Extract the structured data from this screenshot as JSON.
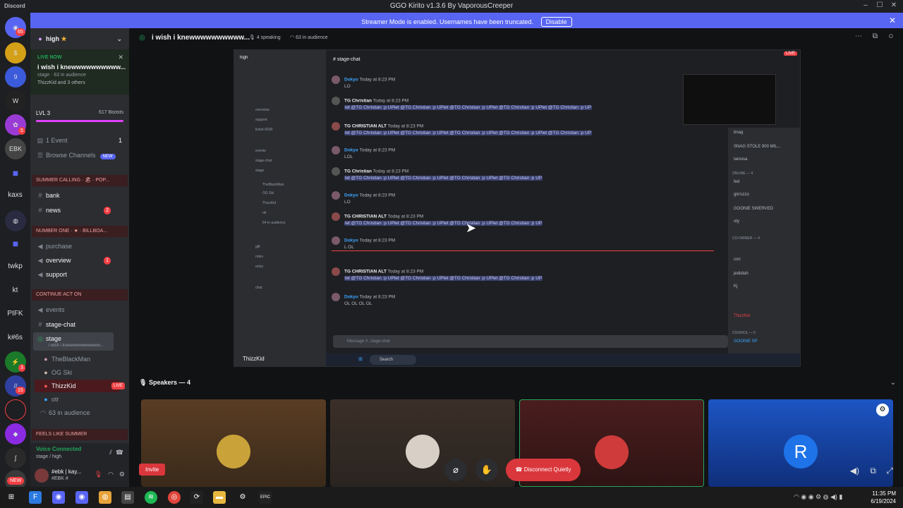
{
  "titlebar": {
    "app": "Discord",
    "title": "GGO Kirito v1.3.6 By VaporousCreeper"
  },
  "streamer_banner": {
    "text": "Streamer Mode is enabled. Usernames have been truncated.",
    "button": "Disable"
  },
  "guild_rail": {
    "badges": [
      "65",
      "5",
      "3",
      "15"
    ],
    "text_items": [
      "kaxs",
      "twkp",
      "kt",
      "PIFK",
      "k#6s"
    ],
    "new_badge": "NEW"
  },
  "sidebar": {
    "server_name": "high",
    "live_label": "LIVE NOW",
    "live_title": "i wish i knewwwwwwwwww...",
    "live_sub": "stage · 63 in audience",
    "live_people": "ThizzKid and 3 others",
    "level": "LVL 3",
    "boosts": "617 Boosts",
    "events": "1 Event",
    "events_count": "1",
    "browse": "Browse Channels",
    "browse_badge": "NEW",
    "cat1": "SUMMER CALLING · 🏖 · POP...",
    "bank": "bank",
    "news": "news",
    "news_badge": "2",
    "cat2": "NUMBER ONE · ★ · BILLBOA...",
    "purchase": "purchase",
    "overview": "overview",
    "overview_badge": "1",
    "support": "support",
    "cat3": "CONTINUE ACT ON",
    "events_ch": "events",
    "stage_chat": "stage-chat",
    "stage": "stage",
    "stage_sub": "i wish i knewwwwwwwwww...",
    "users": [
      "TheBlackMan",
      "OG Ski",
      "ThizzKid",
      "otr"
    ],
    "live_tag": "LIVE",
    "audience": "63 in audience",
    "cat4": "FEELS LIKE SUMMER",
    "voice_connected": "Voice Connected",
    "voice_sub": "stage / high",
    "user_name": "#ebk | kay...",
    "user_tag": "#EBK #"
  },
  "stage_header": {
    "title": "i wish i knewwwwwwwwww...",
    "speaking": "4 speaking",
    "audience": "63 in audience"
  },
  "stream": {
    "mini_server": "high",
    "mini_channels": [
      "overview",
      "support",
      "ticket-0030",
      "events",
      "stage-chat",
      "stage",
      "TheBlackMan",
      "OG Ski",
      "ThizzKid",
      "otr",
      "64 in audience",
      "gift",
      "roles",
      "entry",
      "chat"
    ],
    "mini_user": "ThizzKid",
    "channel": "stage-chat",
    "message_placeholder": "Message #, stage-chat",
    "messages": [
      {
        "name": "Dokyo",
        "time": "Today at 8:23 PM",
        "text": "LO"
      },
      {
        "name": "TG Christian",
        "time": "Today at 8:23 PM",
        "text": "let @TG Christian :p UPlet @TG Christian :p UPlet @TG Christian :p UPlet @TG Christian :p UPlet @TG Christian :p UP"
      },
      {
        "name": "TG CHRISTIAN ALT",
        "time": "Today at 8:23 PM",
        "text": "let @TG Christian :p UPlet @TG Christian :p UPlet @TG Christian :p UPlet @TG Christian :p UPlet @TG Christian :p UP"
      },
      {
        "name": "Dokyo",
        "time": "Today at 8:23 PM",
        "text": "LOL"
      },
      {
        "name": "TG Christian",
        "time": "Today at 8:23 PM",
        "text": "let @TG Christian :p UPlet @TG Christian :p UPlet @TG Christian :p UPlet @TG Christian :p UP"
      },
      {
        "name": "Dokyo",
        "time": "Today at 8:23 PM",
        "text": "LO"
      },
      {
        "name": "TG CHRISTIAN ALT",
        "time": "Today at 8:23 PM",
        "text": "let @TG Christian :p UPlet @TG Christian :p UPlet @TG Christian :p UPlet @TG Christian :p UP"
      },
      {
        "name": "Dokyo",
        "time": "Today at 8:23 PM",
        "text": "L  OL"
      },
      {
        "name": "TG CHRISTIAN ALT",
        "time": "Today at 8:23 PM",
        "text": "let @TG Christian :p UPlet @TG Christian :p UPlet @TG Christian :p UPlet @TG Christian :p UP"
      },
      {
        "name": "Dokyo",
        "time": "Today at 8:23 PM",
        "text": "OL OL OL OL"
      }
    ],
    "members": [
      "bnag",
      "SNAG STOLE 900 MIL...",
      "tainosa",
      "fed",
      "glo'ozzo",
      "GOONIE SWERVED",
      "oty",
      "con",
      "jedidiah",
      "Kj",
      "ThizzKid",
      "GOONIE SP"
    ],
    "member_sections": [
      "ONLINE — 4",
      "CO-OWNER — 4",
      "COUNCIL — 6"
    ],
    "live_tag": "LIVE",
    "taskbar_search": "Search"
  },
  "speakers": {
    "heading": "Speakers — 4",
    "invite": "Invite",
    "disconnect": "Disconnect Quietly"
  },
  "taskbar": {
    "time": "11:35 PM",
    "date": "6/19/2024"
  },
  "colors": {
    "blurple": "#5865f2",
    "red": "#da373c",
    "live": "#ed4245",
    "green": "#23a55a"
  }
}
